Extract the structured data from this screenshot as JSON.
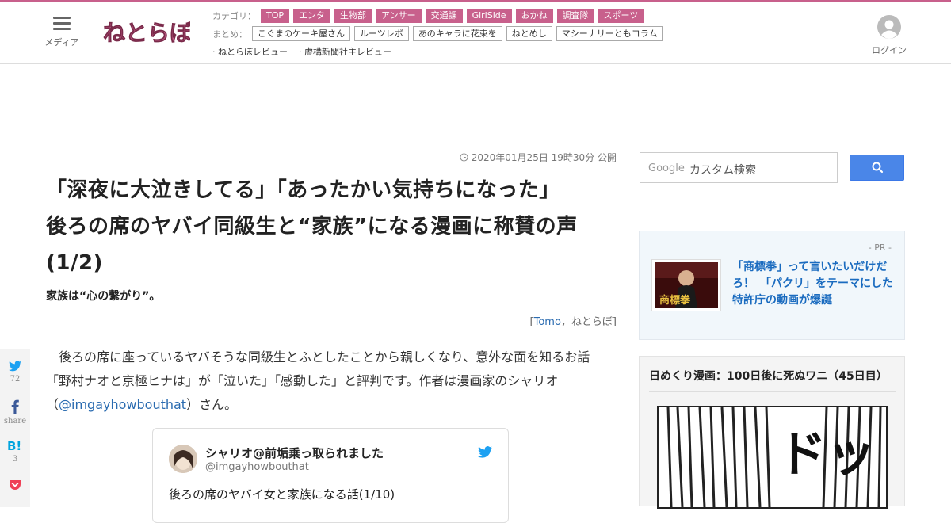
{
  "header": {
    "menu_label": "メディア",
    "logo_alt": "ねとらぼ",
    "category_label": "カテゴリ：",
    "categories": [
      "TOP",
      "エンタ",
      "生物部",
      "アンサー",
      "交通課",
      "GirlSide",
      "おかね",
      "調査隊",
      "スポーツ"
    ],
    "matome_label": "まとめ：",
    "matome": [
      "こぐまのケーキ屋さん",
      "ルーツレポ",
      "あのキャラに花束を",
      "ねとめし",
      "マシーナリーともコラム"
    ],
    "extra_links": [
      "· ねとらぼレビュー",
      "· 虚構新聞社主レビュー"
    ],
    "login_label": "ログイン"
  },
  "article": {
    "date": "2020年01月25日 19時30分 公開",
    "title_line1": "「深夜に大泣きしてる」「あったかい気持ちになった」",
    "title_line2": "後ろの席のヤバイ同級生と“家族”になる漫画に称賛の声",
    "title_line3": "(1/2)",
    "subtitle": "家族は“心の繋がり”。",
    "byline_open": "[",
    "byline_author": "Tomo",
    "byline_rest": "，ねとらぼ]",
    "para_line1": "　後ろの席に座っているヤバそうな同級生とふとしたことから親しくなり、意外な面を知るお話",
    "para_line2": "「野村ナオと京極ヒナは」が「泣いた」「感動した」と評判です。作者は漫画家のシャリオ",
    "para_line3_pre": "（",
    "para_line3_link": "@imgayhowbouthat",
    "para_line3_post": "）さん。"
  },
  "tweet": {
    "name": "シャリオ@前垢乗っ取られました",
    "handle": "@imgayhowbouthat",
    "text": "後ろの席のヤバイ女と家族になる話(1/10)"
  },
  "share": {
    "twitter_count": "72",
    "facebook_label": "share",
    "hatena_count": "3"
  },
  "sidebar": {
    "search_brand": "Google",
    "search_placeholder": "カスタム検索",
    "pr_label": "- PR -",
    "pr_text": "「商標拳」って言いたいだけだろ！　「パクリ」をテーマにした特許庁の動画が爆誕",
    "pr_thumb_text": "商標拳",
    "manga_title": "日めくり漫画：100日後に死ぬワニ（45日目）",
    "manga_sfx": "ドッ"
  },
  "colors": {
    "brand_pink": "#c8608c",
    "link_blue": "#2a6bb0",
    "search_blue": "#4a86e8",
    "twitter_blue": "#1da1f2",
    "facebook_blue": "#3b5998",
    "hatena_blue": "#00a4de",
    "pocket_red": "#ef4056"
  },
  "icons": {
    "menu": "hamburger-icon",
    "login": "user-avatar-icon",
    "clock": "clock-icon",
    "search": "search-icon",
    "twitter": "twitter-bird-icon",
    "facebook": "facebook-icon",
    "hatena": "hatena-bookmark-icon",
    "pocket": "pocket-icon"
  }
}
